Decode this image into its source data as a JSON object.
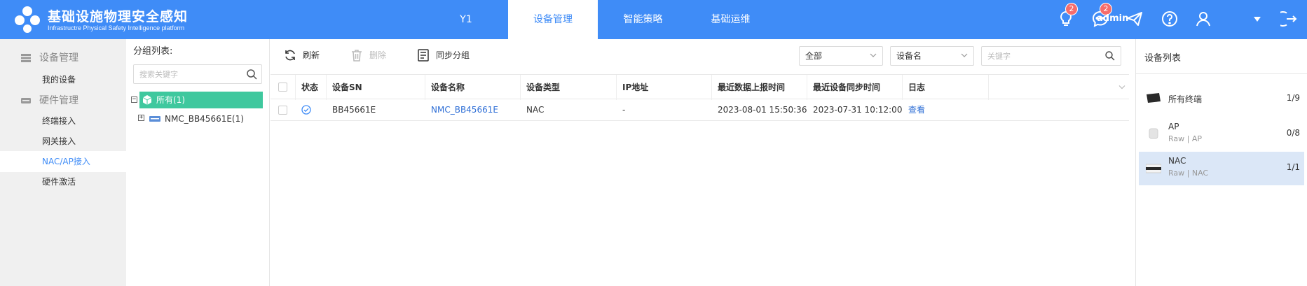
{
  "header": {
    "title": "基础设施物理安全感知",
    "subtitle": "Infrastructre Physical Safety Intelligence platform",
    "tabs": [
      {
        "label": "Y1"
      },
      {
        "label": "设备管理"
      },
      {
        "label": "智能策略"
      },
      {
        "label": "基础运维"
      }
    ],
    "active_tab": "设备管理",
    "notifications": {
      "lightbulb_badge": "2",
      "message_badge": "2"
    },
    "icons": [
      "lightbulb-icon",
      "message-icon",
      "send-icon",
      "help-icon",
      "user-icon",
      "logout-icon"
    ],
    "user": "admin",
    "colors": {
      "primary": "#3f8cf7",
      "badge": "#f56c6c"
    }
  },
  "sidebar": {
    "groups": [
      {
        "label": "设备管理",
        "items": [
          {
            "label": "我的设备"
          }
        ]
      },
      {
        "label": "硬件管理",
        "items": [
          {
            "label": "终端接入"
          },
          {
            "label": "网关接入"
          },
          {
            "label": "NAC/AP接入"
          },
          {
            "label": "硬件激活"
          }
        ]
      }
    ],
    "active_item": "NAC/AP接入"
  },
  "group_panel": {
    "title": "分组列表:",
    "search_placeholder": "搜索关键字",
    "tree": {
      "root": {
        "label": "所有(1)",
        "toggle": "−",
        "color": "#3fc89e"
      },
      "children": [
        {
          "label": "NMC_BB45661E(1)",
          "toggle": "+"
        }
      ]
    }
  },
  "toolbar": {
    "refresh": "刷新",
    "delete": "删除",
    "sync_group": "同步分组",
    "filter_select": "全部",
    "field_select": "设备名",
    "keyword_placeholder": "关键字"
  },
  "table": {
    "columns": {
      "status": "状态",
      "sn": "设备SN",
      "name": "设备名称",
      "type": "设备类型",
      "ip": "IP地址",
      "last_report": "最近数据上报时间",
      "last_sync": "最近设备同步时间",
      "log": "日志"
    },
    "rows": [
      {
        "status": "online",
        "sn": "BB45661E",
        "name": "NMC_BB45661E",
        "type": "NAC",
        "ip": "-",
        "last_report": "2023-08-01 15:50:36",
        "last_sync": "2023-07-31 10:12:00",
        "log": "查看"
      }
    ]
  },
  "device_list": {
    "title": "设备列表",
    "items": [
      {
        "name": "所有终端",
        "sub": "",
        "count": "1/9"
      },
      {
        "name": "AP",
        "sub": "Raw | AP",
        "count": "0/8"
      },
      {
        "name": "NAC",
        "sub": "Raw | NAC",
        "count": "1/1"
      }
    ],
    "active": "NAC"
  }
}
